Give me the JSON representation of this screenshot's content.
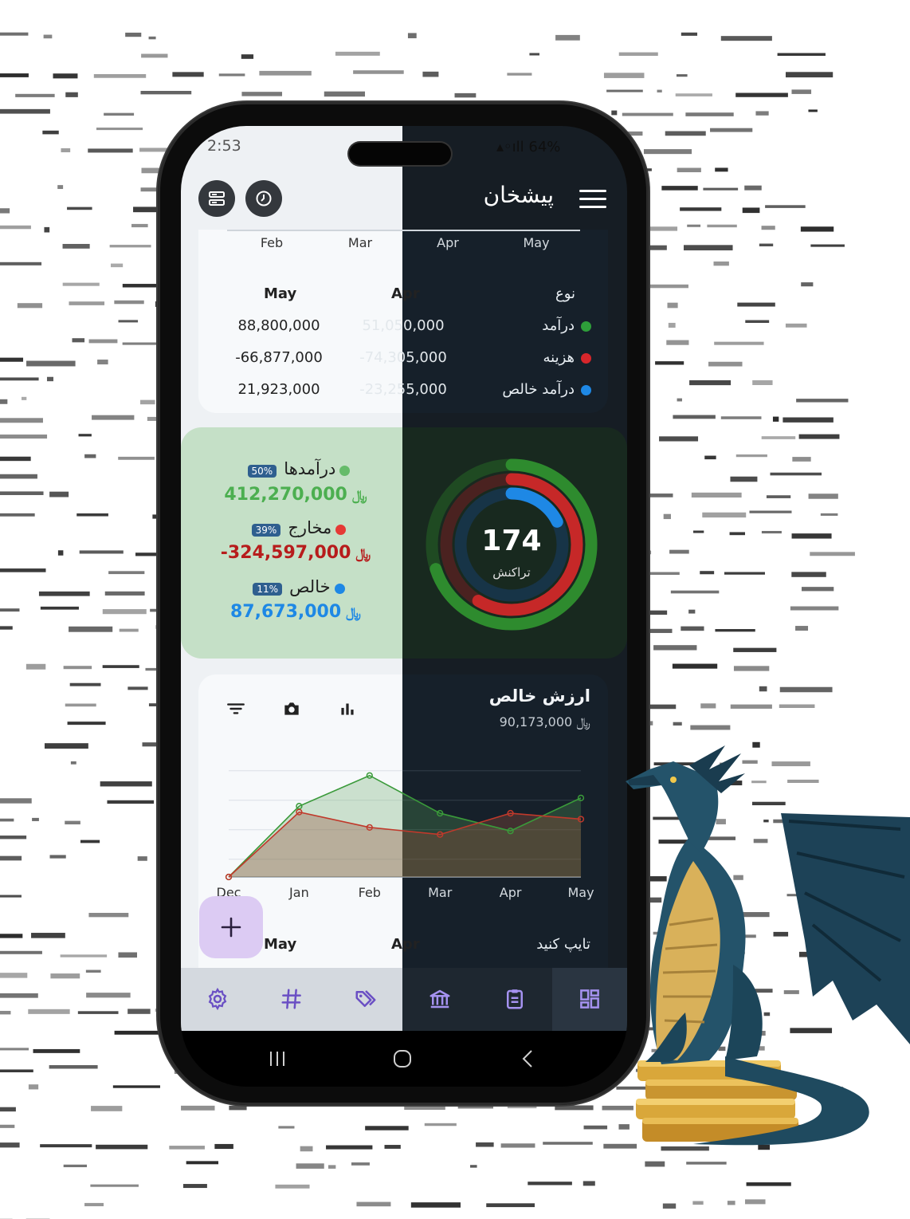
{
  "status": {
    "time": "2:53",
    "battery": "64%"
  },
  "header": {
    "title": "پیشخان"
  },
  "months_top": [
    "Feb",
    "Mar",
    "Apr",
    "May"
  ],
  "summary_table": {
    "type_header": "نوع",
    "col_may": "May",
    "col_apr": "Apr",
    "rows": [
      {
        "label": "درآمد",
        "color": "#2e9e3a",
        "may": "88,800,000",
        "apr": "51,050,000"
      },
      {
        "label": "هزینه",
        "color": "#d7262b",
        "may": "-66,877,000",
        "apr": "-74,305,000"
      },
      {
        "label": "درآمد خالص",
        "color": "#1e88e5",
        "may": "21,923,000",
        "apr": "-23,255,000"
      }
    ]
  },
  "totals": {
    "incomes": {
      "label": "درآمدها",
      "percent": "50%",
      "amount": "412,270,000",
      "currency": "﷼",
      "color": "#4caf50"
    },
    "expenses": {
      "label": "مخارج",
      "percent": "39%",
      "amount": "-324,597,000",
      "currency": "﷼",
      "color": "#b71c1c"
    },
    "net": {
      "label": "خالص",
      "percent": "11%",
      "amount": "87,673,000",
      "currency": "﷼",
      "color": "#1e88e5"
    },
    "ring_count": "174",
    "ring_label": "تراکنش",
    "ring_fractions": {
      "income": 0.5,
      "expense": 0.39,
      "net": 0.11
    }
  },
  "net_worth": {
    "title": "ارزش خالص",
    "value": "90,173,000",
    "currency": "﷼"
  },
  "chart_data": {
    "type": "area",
    "categories": [
      "Dec",
      "Jan",
      "Feb",
      "Mar",
      "Apr",
      "May"
    ],
    "series": [
      {
        "color": "#3a9a3a",
        "values": [
          0,
          60,
          86,
          54,
          39,
          67
        ]
      },
      {
        "color": "#c0392b",
        "values": [
          0,
          55,
          42,
          36,
          54,
          49
        ]
      }
    ],
    "ylim": [
      0,
      100
    ]
  },
  "bottom_table": {
    "col_may": "May",
    "col_apr": "Apr",
    "type_prompt": "تایپ کنید"
  },
  "icons": {
    "left_buttons": [
      "list-icon",
      "history-icon"
    ],
    "toolbar": [
      "filter-icon",
      "camera-icon",
      "bar-chart-icon"
    ],
    "nav": [
      "settings-icon",
      "hashtag-icon",
      "tags-icon",
      "bank-icon",
      "clipboard-icon",
      "dashboard-icon"
    ],
    "system": [
      "recents-icon",
      "home-icon",
      "back-icon"
    ]
  }
}
